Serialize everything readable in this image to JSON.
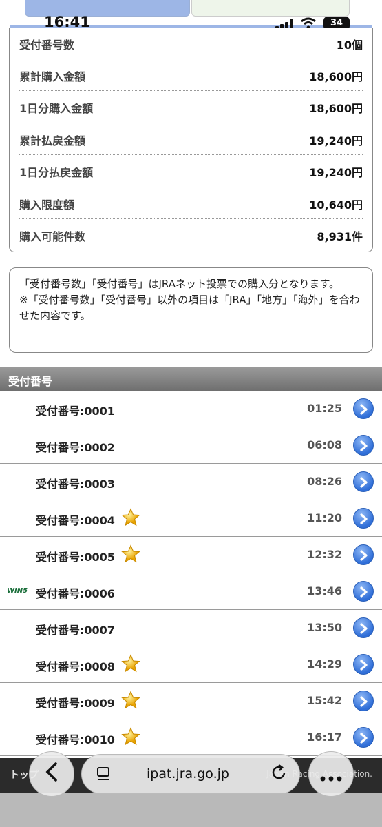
{
  "status_bar": {
    "time": "16:41",
    "battery": "34"
  },
  "summary": [
    {
      "label": "受付番号数",
      "value": "10個"
    },
    {
      "label": "累計購入金額",
      "value": "18,600円"
    },
    {
      "label": "1日分購入金額",
      "value": "18,600円"
    },
    {
      "label": "累計払戻金額",
      "value": "19,240円"
    },
    {
      "label": "1日分払戻金額",
      "value": "19,240円"
    },
    {
      "label": "購入限度額",
      "value": "10,640円"
    },
    {
      "label": "購入可能件数",
      "value": "8,931件"
    }
  ],
  "note": {
    "line1": "「受付番号数」「受付番号」はJRAネット投票での購入分となります。",
    "line2": "※「受付番号数」「受付番号」以外の項目は「JRA」「地方」「海外」を合わせた内容です。"
  },
  "section_title": "受付番号",
  "receipts": [
    {
      "name": "受付番号:0001",
      "time": "01:25",
      "star": false,
      "win5": false
    },
    {
      "name": "受付番号:0002",
      "time": "06:08",
      "star": false,
      "win5": false
    },
    {
      "name": "受付番号:0003",
      "time": "08:26",
      "star": false,
      "win5": false
    },
    {
      "name": "受付番号:0004",
      "time": "11:20",
      "star": true,
      "win5": false
    },
    {
      "name": "受付番号:0005",
      "time": "12:32",
      "star": true,
      "win5": false
    },
    {
      "name": "受付番号:0006",
      "time": "13:46",
      "star": false,
      "win5": true
    },
    {
      "name": "受付番号:0007",
      "time": "13:50",
      "star": false,
      "win5": false
    },
    {
      "name": "受付番号:0008",
      "time": "14:29",
      "star": true,
      "win5": false
    },
    {
      "name": "受付番号:0009",
      "time": "15:42",
      "star": true,
      "win5": false
    },
    {
      "name": "受付番号:0010",
      "time": "16:17",
      "star": true,
      "win5": false
    }
  ],
  "win5_label": "WIN5",
  "footer": {
    "left": "トップ",
    "right": "Japan Racing Association."
  },
  "browser": {
    "url": "ipat.jra.go.jp"
  },
  "colors": {
    "accent": "#2f6ed8",
    "tab_active": "#9db6e6",
    "header_bg": "#7f7f7f"
  }
}
